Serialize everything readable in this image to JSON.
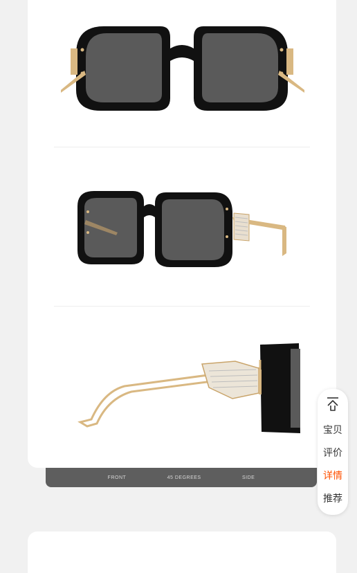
{
  "angles": [
    "FRONT",
    "45 DEGREES",
    "SIDE"
  ],
  "side_nav": {
    "items": [
      {
        "label": "宝贝",
        "active": false
      },
      {
        "label": "评价",
        "active": false
      },
      {
        "label": "详情",
        "active": true
      },
      {
        "label": "推荐",
        "active": false
      }
    ],
    "active_color": "#ff5000"
  },
  "colors": {
    "frame": "#111111",
    "lens": "#5a5a5a",
    "gold": "#d9b882"
  }
}
